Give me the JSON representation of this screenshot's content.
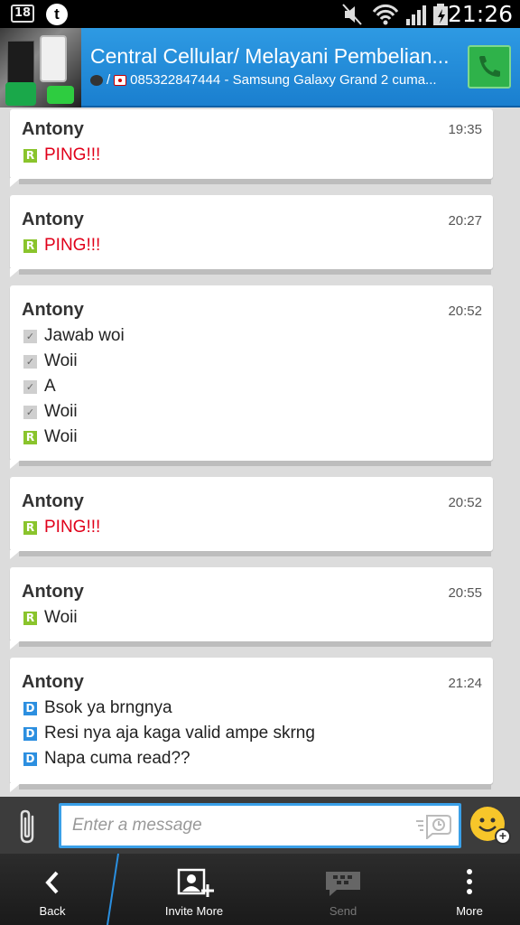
{
  "status_bar": {
    "notification_count": "18",
    "app_icon_letter": "t",
    "time": "21:26"
  },
  "header": {
    "title": "Central Cellular/ Melayani Pembelian...",
    "subtitle": "085322847444 - Samsung Galaxy Grand 2 cuma..."
  },
  "messages": [
    {
      "sender": "Antony",
      "time": "19:35",
      "lines": [
        {
          "status": "R",
          "text": "PING!!!"
        }
      ]
    },
    {
      "sender": "Antony",
      "time": "20:27",
      "lines": [
        {
          "status": "R",
          "text": "PING!!!"
        }
      ]
    },
    {
      "sender": "Antony",
      "time": "20:52",
      "lines": [
        {
          "status": "✓",
          "text": "Jawab woi"
        },
        {
          "status": "✓",
          "text": "Woii"
        },
        {
          "status": "✓",
          "text": "A"
        },
        {
          "status": "✓",
          "text": "Woii"
        },
        {
          "status": "R",
          "text": "Woii"
        }
      ]
    },
    {
      "sender": "Antony",
      "time": "20:52",
      "lines": [
        {
          "status": "R",
          "text": "PING!!!"
        }
      ]
    },
    {
      "sender": "Antony",
      "time": "20:55",
      "lines": [
        {
          "status": "R",
          "text": "Woii"
        }
      ]
    },
    {
      "sender": "Antony",
      "time": "21:24",
      "lines": [
        {
          "status": "D",
          "text": "Bsok ya brngnya"
        },
        {
          "status": "D",
          "text": "Resi nya aja kaga valid ampe skrng"
        },
        {
          "status": "D",
          "text": "Napa cuma read??"
        }
      ]
    }
  ],
  "composer": {
    "placeholder": "Enter a message"
  },
  "actions": {
    "back": "Back",
    "invite": "Invite More",
    "send": "Send",
    "more": "More"
  },
  "colors": {
    "header_blue": "#1f8ad8",
    "ping_red": "#e0001a",
    "read_green": "#8ac42c",
    "delivered_blue": "#2c8fe0"
  }
}
